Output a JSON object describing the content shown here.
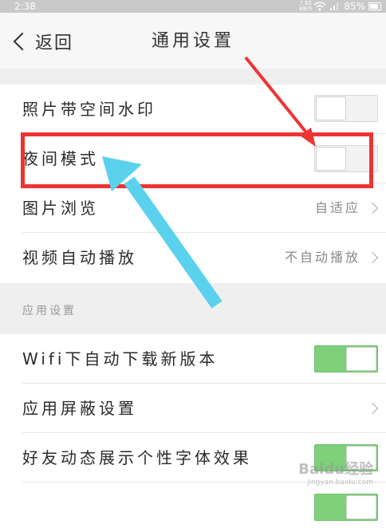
{
  "statusbar": {
    "time": "2:38",
    "network_speed": "7.62 KB/S",
    "battery": "85%"
  },
  "navbar": {
    "back_label": "返回",
    "title": "通用设置"
  },
  "rows": [
    {
      "label": "照片带空间水印",
      "control": "toggle",
      "state": "off"
    },
    {
      "label": "夜间模式",
      "control": "toggle",
      "state": "off"
    },
    {
      "label": "图片浏览",
      "value": "自适应",
      "control": "arrow"
    },
    {
      "label": "视频自动播放",
      "value": "不自动播放",
      "control": "arrow"
    }
  ],
  "section": {
    "title": "应用设置"
  },
  "app_rows": [
    {
      "label": "Wifi下自动下载新版本",
      "control": "toggle",
      "state": "on"
    },
    {
      "label": "应用屏蔽设置",
      "control": "arrow"
    },
    {
      "label": "好友动态展示个性字体效果",
      "control": "toggle",
      "state": "on"
    }
  ],
  "annotation": {
    "red_arrow_color": "#ee3333",
    "blue_arrow_color": "#5ad2ee"
  },
  "watermark": {
    "text": "Baidu经验",
    "subtext": "jingyan.baidu.com"
  }
}
